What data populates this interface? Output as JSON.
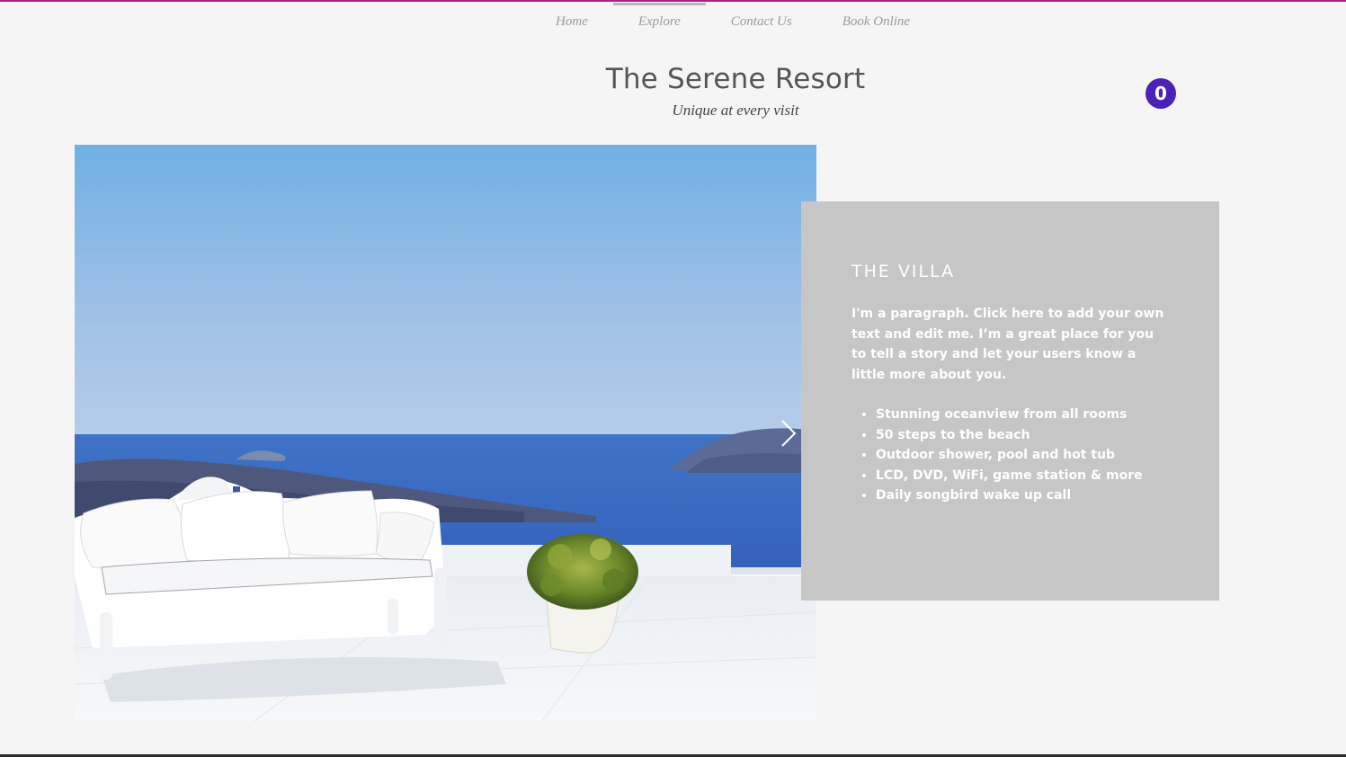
{
  "nav": {
    "items": [
      {
        "label": "Home"
      },
      {
        "label": "Explore"
      },
      {
        "label": "Contact Us"
      },
      {
        "label": "Book Online"
      }
    ],
    "active": "Explore"
  },
  "header": {
    "title": "The Serene Resort",
    "tagline": "Unique at every visit"
  },
  "cart": {
    "count": "0",
    "color": "#4a22b8"
  },
  "slideshow": {
    "image_subject": "white bench with cushions on a terrace overlooking a blue sea and islands, potted shrub",
    "next_icon": "chevron-right-icon"
  },
  "villa": {
    "title": "THE VILLA",
    "paragraph": "I'm a paragraph. Click here to add your own text and edit me. I’m a great place for you to tell a story and let your users know a little more about you.",
    "features": [
      "Stunning oceanview from all rooms",
      "50 steps to the beach",
      "Outdoor shower, pool and hot tub",
      "LCD, DVD, WiFi, game station & more",
      "Daily songbird wake up call"
    ]
  },
  "colors": {
    "accent_top_line": "#9c2a8a",
    "info_box": "#c6c6c6",
    "background": "#f5f5f5"
  }
}
